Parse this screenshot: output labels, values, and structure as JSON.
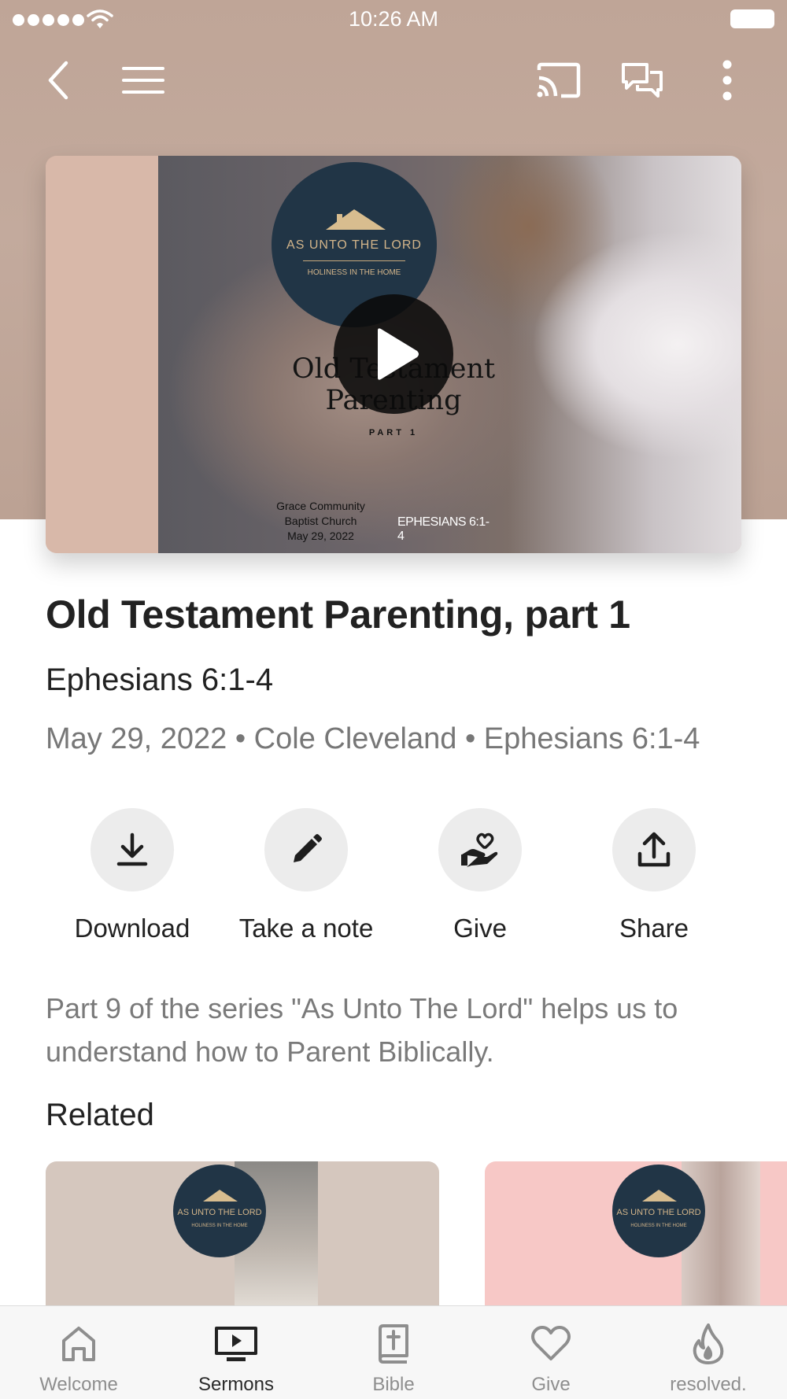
{
  "status_bar": {
    "time": "10:26 AM"
  },
  "toolbar": {
    "back": "back-icon",
    "menu": "menu-icon",
    "cast": "cast-icon",
    "chat": "chat-icon",
    "more": "more-vertical-icon"
  },
  "media": {
    "artwork": {
      "logo_title": "AS UNTO THE LORD",
      "logo_subtitle": "HOLINESS IN THE HOME",
      "title_line1": "Old Testament",
      "title_line2": "Parenting",
      "part": "PART 1",
      "church_line1": "Grace Community",
      "church_line2": "Baptist Church",
      "church_line3": "May 29, 2022",
      "verse": "EPHESIANS 6:1-4"
    },
    "play": "play-icon"
  },
  "sermon": {
    "title": "Old Testament Parenting, part 1",
    "passage": "Ephesians 6:1-4",
    "meta": "May 29, 2022 • Cole Cleveland • Ephesians 6:1-4",
    "description": "Part 9 of the series \"As Unto The Lord\" helps us to understand how to Parent Biblically."
  },
  "actions": [
    {
      "label": "Download",
      "icon": "download-icon"
    },
    {
      "label": "Take a note",
      "icon": "pencil-icon"
    },
    {
      "label": "Give",
      "icon": "give-hand-heart-icon"
    },
    {
      "label": "Share",
      "icon": "share-icon"
    }
  ],
  "related": {
    "heading": "Related",
    "cards": [
      {
        "logo_title": "AS UNTO THE LORD",
        "logo_subtitle": "HOLINESS IN THE HOME",
        "color": "#d5c7be"
      },
      {
        "logo_title": "AS UNTO THE LORD",
        "logo_subtitle": "HOLINESS IN THE HOME",
        "color": "#f7c8c6"
      }
    ]
  },
  "tabs": [
    {
      "label": "Welcome",
      "icon": "home-icon",
      "active": false
    },
    {
      "label": "Sermons",
      "icon": "tv-play-icon",
      "active": true
    },
    {
      "label": "Bible",
      "icon": "bible-icon",
      "active": false
    },
    {
      "label": "Give",
      "icon": "heart-icon",
      "active": false
    },
    {
      "label": "resolved.",
      "icon": "flame-icon",
      "active": false
    }
  ],
  "colors": {
    "header_bg": "#c0a698",
    "logo_navy": "#213546",
    "logo_gold": "#d3b58a",
    "action_circle": "#ececec",
    "text_muted": "#777777"
  }
}
